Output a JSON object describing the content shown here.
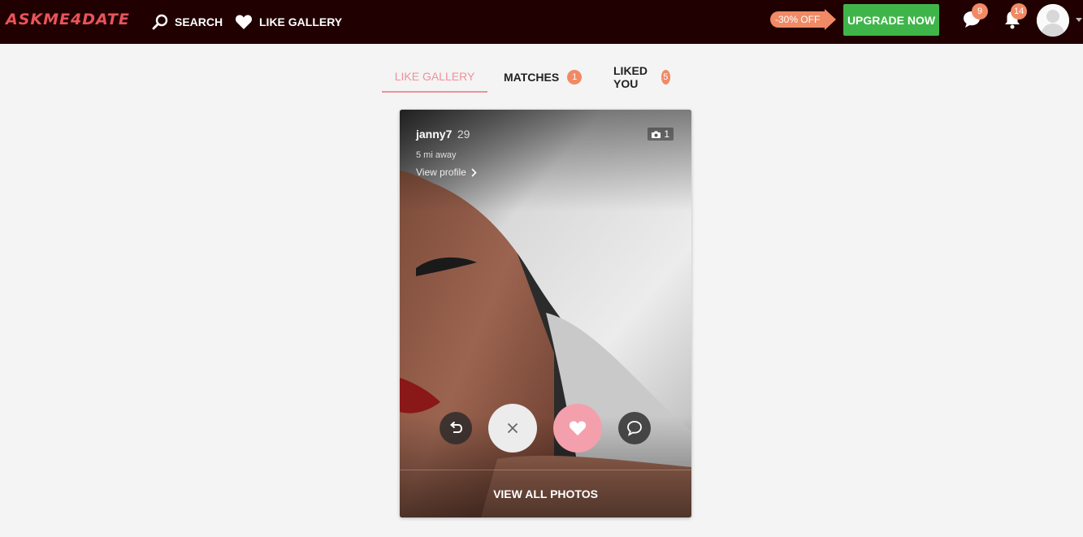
{
  "header": {
    "logo": "ASKME4DATE",
    "search_label": "SEARCH",
    "like_gallery_label": "LIKE GALLERY",
    "promo": "-30% OFF",
    "upgrade_label": "UPGRADE NOW",
    "messages_count": "9",
    "notifications_count": "14"
  },
  "tabs": [
    {
      "label": "LIKE GALLERY"
    },
    {
      "label": "MATCHES",
      "badge": "1"
    },
    {
      "label": "LIKED YOU",
      "badge": "5"
    }
  ],
  "card": {
    "username": "janny7",
    "age": "29",
    "distance": "5 mi away",
    "view_profile": "View profile",
    "photo_count": "1",
    "view_all_photos": "VIEW ALL PHOTOS"
  },
  "colors": {
    "header_bg": "#200000",
    "logo": "#e8545a",
    "accent_pink": "#f0909a",
    "badge_orange": "#f08a65",
    "upgrade_green": "#3fb549"
  }
}
